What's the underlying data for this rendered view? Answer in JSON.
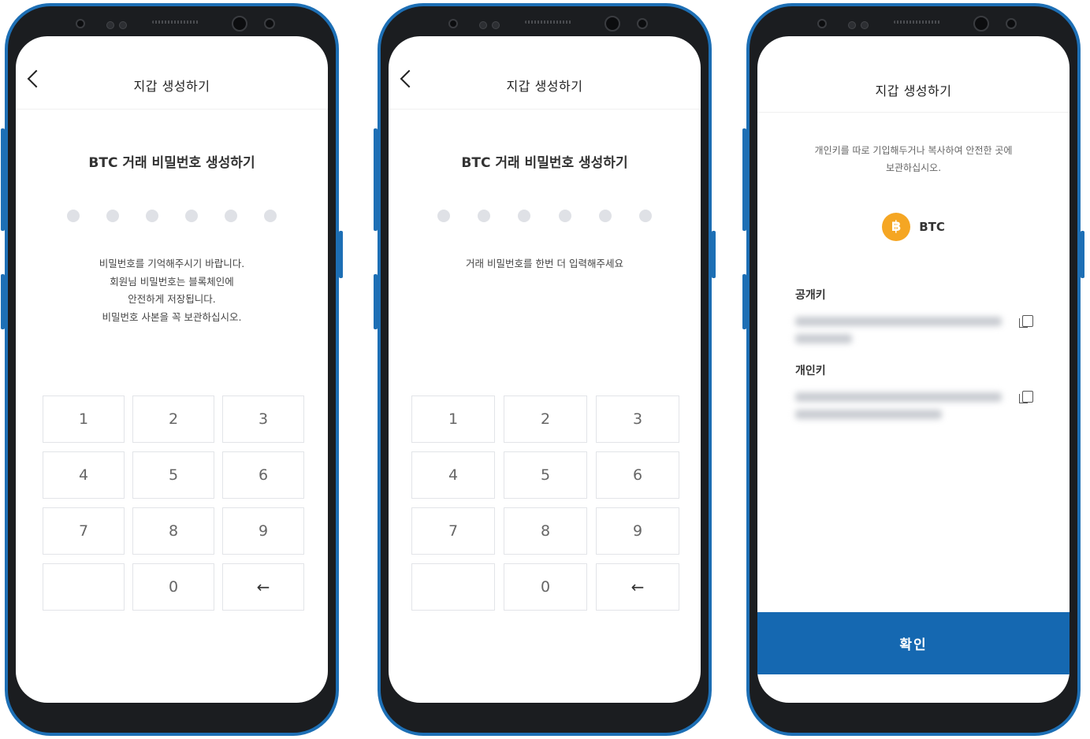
{
  "screens": [
    {
      "title": "지갑 생성하기",
      "subtitle": "BTC  거래 비밀번호 생성하기",
      "pin_length": 6,
      "pin_filled": 0,
      "description": "비밀번호를 기억해주시기 바랍니다.\n회원님 비밀번호는 블록체인에\n안전하게 저장됩니다.\n비밀번호 사본을 꼭 보관하십시오.",
      "keys": [
        "1",
        "2",
        "3",
        "4",
        "5",
        "6",
        "7",
        "8",
        "9",
        "",
        "0",
        "←"
      ]
    },
    {
      "title": "지갑 생성하기",
      "subtitle": "BTC  거래 비밀번호 생성하기",
      "pin_length": 6,
      "pin_filled": 0,
      "description": "거래 비밀번호를 한번 더 입력해주세요",
      "keys": [
        "1",
        "2",
        "3",
        "4",
        "5",
        "6",
        "7",
        "8",
        "9",
        "",
        "0",
        "←"
      ]
    },
    {
      "title": "지갑 생성하기",
      "info": "개인키를 따로 기입해두거나 복사하여 안전한 곳에\n보관하십시오.",
      "coin": {
        "symbol": "BTC",
        "icon": "bitcoin-icon",
        "color": "#f5a623"
      },
      "public_key_label": "공개키",
      "private_key_label": "개인키",
      "confirm_label": "확인",
      "accent_color": "#1568b1"
    }
  ]
}
